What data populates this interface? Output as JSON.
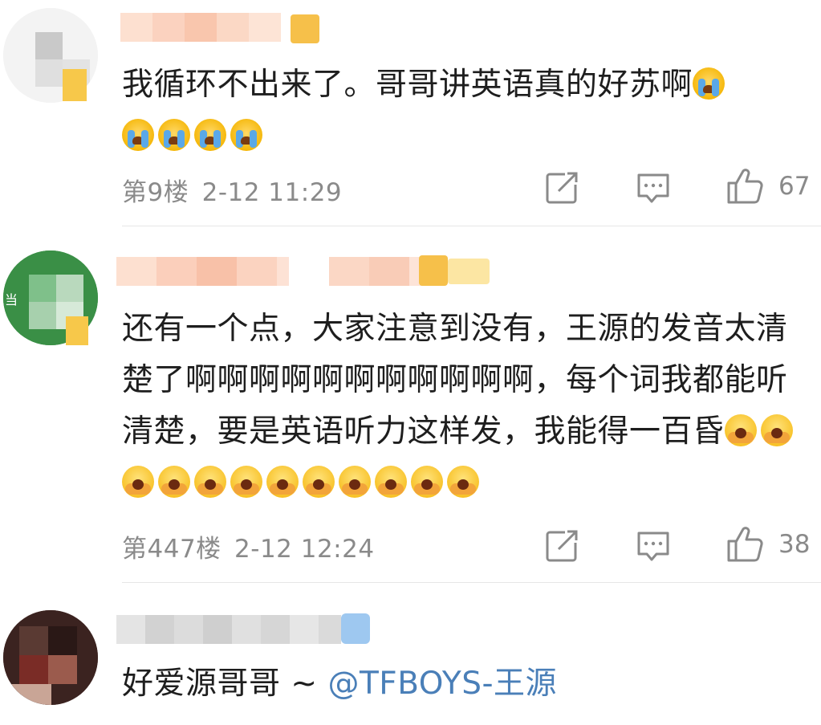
{
  "comments": [
    {
      "text": "我循环不出来了。哥哥讲英语真的好苏啊",
      "emojis": [
        "cry-emoji",
        "cry-emoji",
        "cry-emoji",
        "cry-emoji",
        "cry-emoji"
      ],
      "floor": "第9楼",
      "time": "2-12 11:29",
      "likes": "67"
    },
    {
      "avatar_text": "当",
      "text": "还有一个点，大家注意到没有，王源的发音太清楚了啊啊啊啊啊啊啊啊啊啊啊，每个词我都能听清楚，要是英语听力这样发，我能得一百昏",
      "emojis": [
        "scared-emoji",
        "scared-emoji",
        "scared-emoji",
        "scared-emoji",
        "scared-emoji",
        "scared-emoji",
        "scared-emoji",
        "scared-emoji",
        "scared-emoji",
        "scared-emoji",
        "scared-emoji",
        "scared-emoji"
      ],
      "floor": "第447楼",
      "time": "2-12 12:24",
      "likes": "38"
    },
    {
      "text": "好爱源哥哥 ~ ",
      "mention": "@TFBOYS-王源"
    }
  ],
  "icons": {
    "repost": "share-edit-icon",
    "reply": "comment-icon",
    "like": "thumbs-up-icon"
  },
  "colors": {
    "meta": "#8a8a8a",
    "mention": "#4a7fb8",
    "divider": "#e6e6e6"
  }
}
